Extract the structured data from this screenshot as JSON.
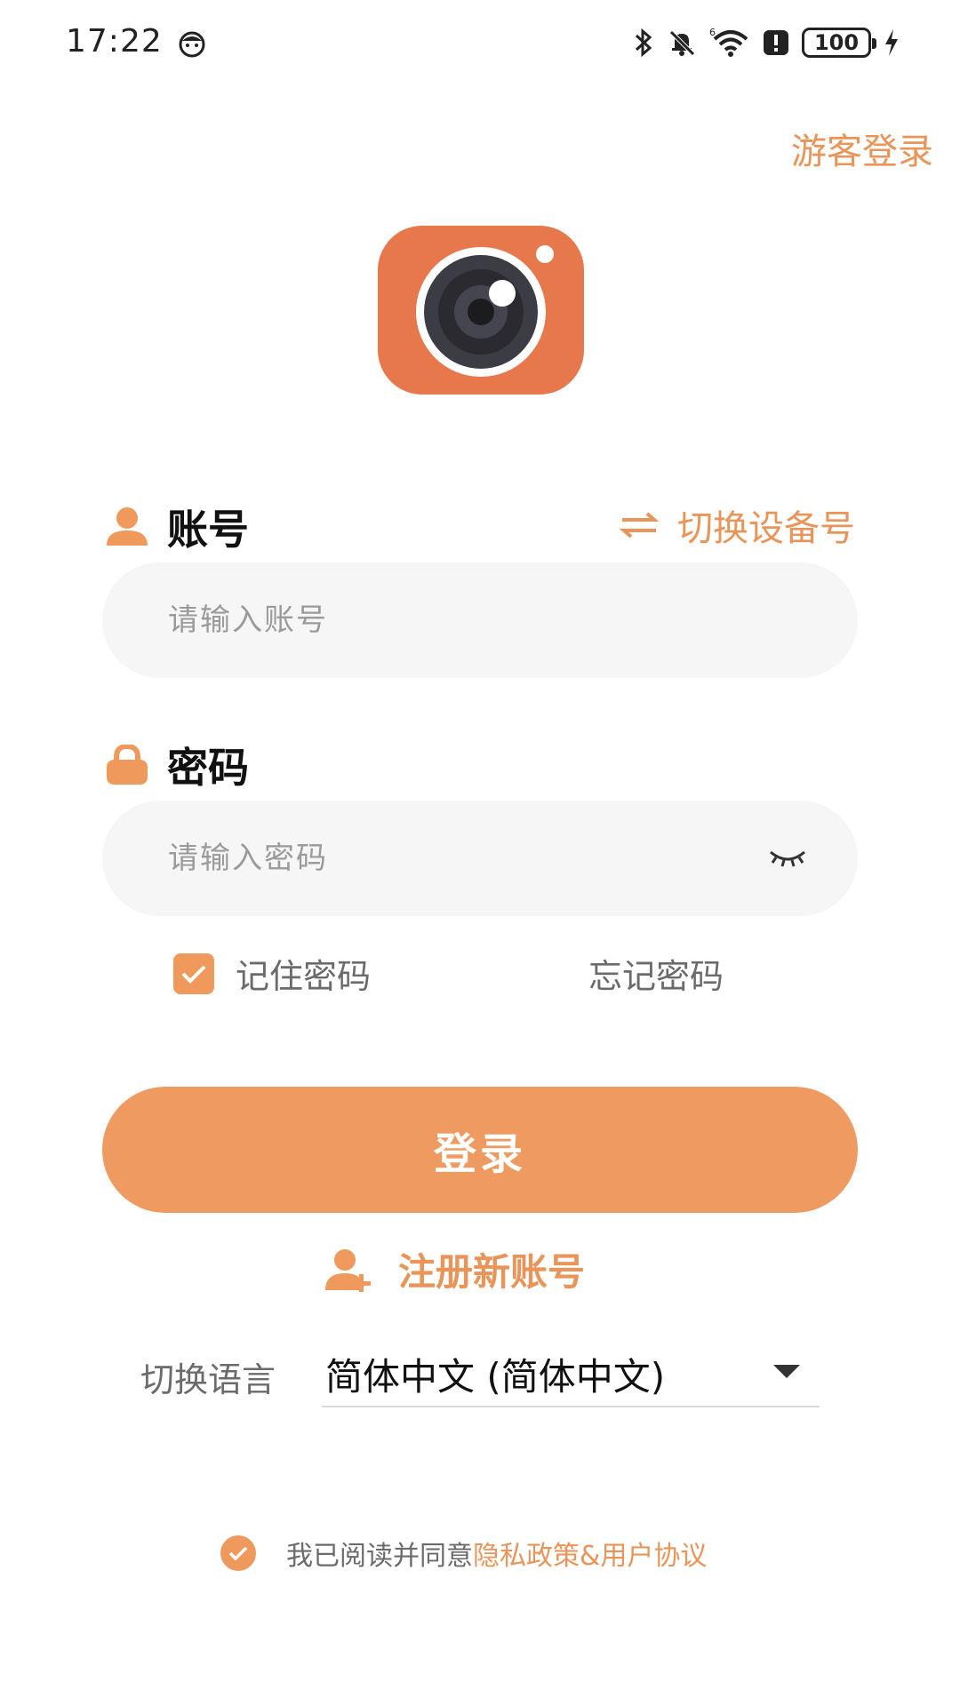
{
  "status_bar": {
    "time": "17:22",
    "battery": "100",
    "icons": [
      "face-icon",
      "bluetooth-icon",
      "mute-bell-icon",
      "wifi-icon",
      "alert-icon",
      "battery-icon",
      "charging-icon"
    ]
  },
  "header": {
    "guest_login": "游客登录"
  },
  "account": {
    "label": "账号",
    "switch_device": "切换设备号",
    "placeholder": "请输入账号"
  },
  "password": {
    "label": "密码",
    "placeholder": "请输入密码"
  },
  "options": {
    "remember": "记住密码",
    "forgot": "忘记密码",
    "remember_checked": true
  },
  "login_button": "登录",
  "register": "注册新账号",
  "language": {
    "label": "切换语言",
    "value": "简体中文 (简体中文)"
  },
  "agreement": {
    "prefix": "我已阅读并同意",
    "link": "隐私政策&用户协议",
    "checked": true
  },
  "colors": {
    "accent": "#ef9a60",
    "accent_text": "#e9955a",
    "logo_bg": "#e6784c",
    "input_bg": "#f6f6f6"
  }
}
